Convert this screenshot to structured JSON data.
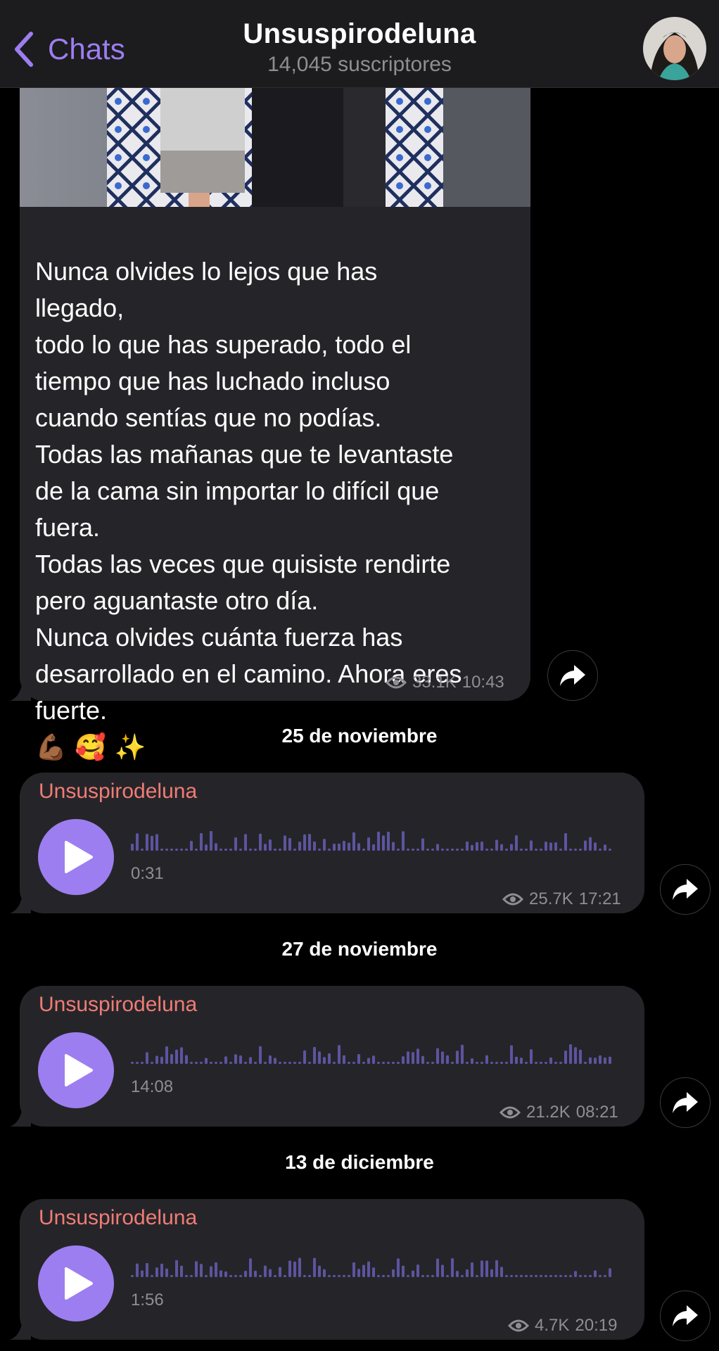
{
  "header": {
    "back_label": "Chats",
    "title": "Unsuspirodeluna",
    "subtitle": "14,045 suscriptores"
  },
  "post": {
    "text": "Nunca olvides lo lejos que has\nllegado,\ntodo lo que has superado, todo el\ntiempo que has luchado incluso\ncuando sentías que no podías.\nTodas las mañanas que te levantaste\nde la cama sin importar lo difícil que\nfuera.\nTodas las veces que quisiste rendirte\npero aguantaste otro día.\nNunca olvides cuánta fuerza has\ndesarrollado en el camino. Ahora eres\nfuerte.",
    "emojis": "💪🏾 🥰 ✨",
    "views": "33.1K",
    "time": "10:43"
  },
  "voice_messages": [
    {
      "date": "25 de noviembre",
      "sender": "Unsuspirodeluna",
      "duration": "0:31",
      "views": "25.7K",
      "time": "17:21"
    },
    {
      "date": "27 de noviembre",
      "sender": "Unsuspirodeluna",
      "duration": "14:08",
      "views": "21.2K",
      "time": "08:21"
    },
    {
      "date": "13 de diciembre",
      "sender": "Unsuspirodeluna",
      "duration": "1:56",
      "views": "4.7K",
      "time": "20:19"
    }
  ],
  "icons": {
    "back": "chevron-left-icon",
    "views": "eye-icon",
    "forward": "share-arrow-icon",
    "play": "play-icon"
  },
  "colors": {
    "accent": "#9d7ef0",
    "sender": "#f07c76",
    "bubble": "#252529",
    "header": "#1c1c1e",
    "waveform": "#5d54a0",
    "meta_text": "#8e8e93"
  }
}
